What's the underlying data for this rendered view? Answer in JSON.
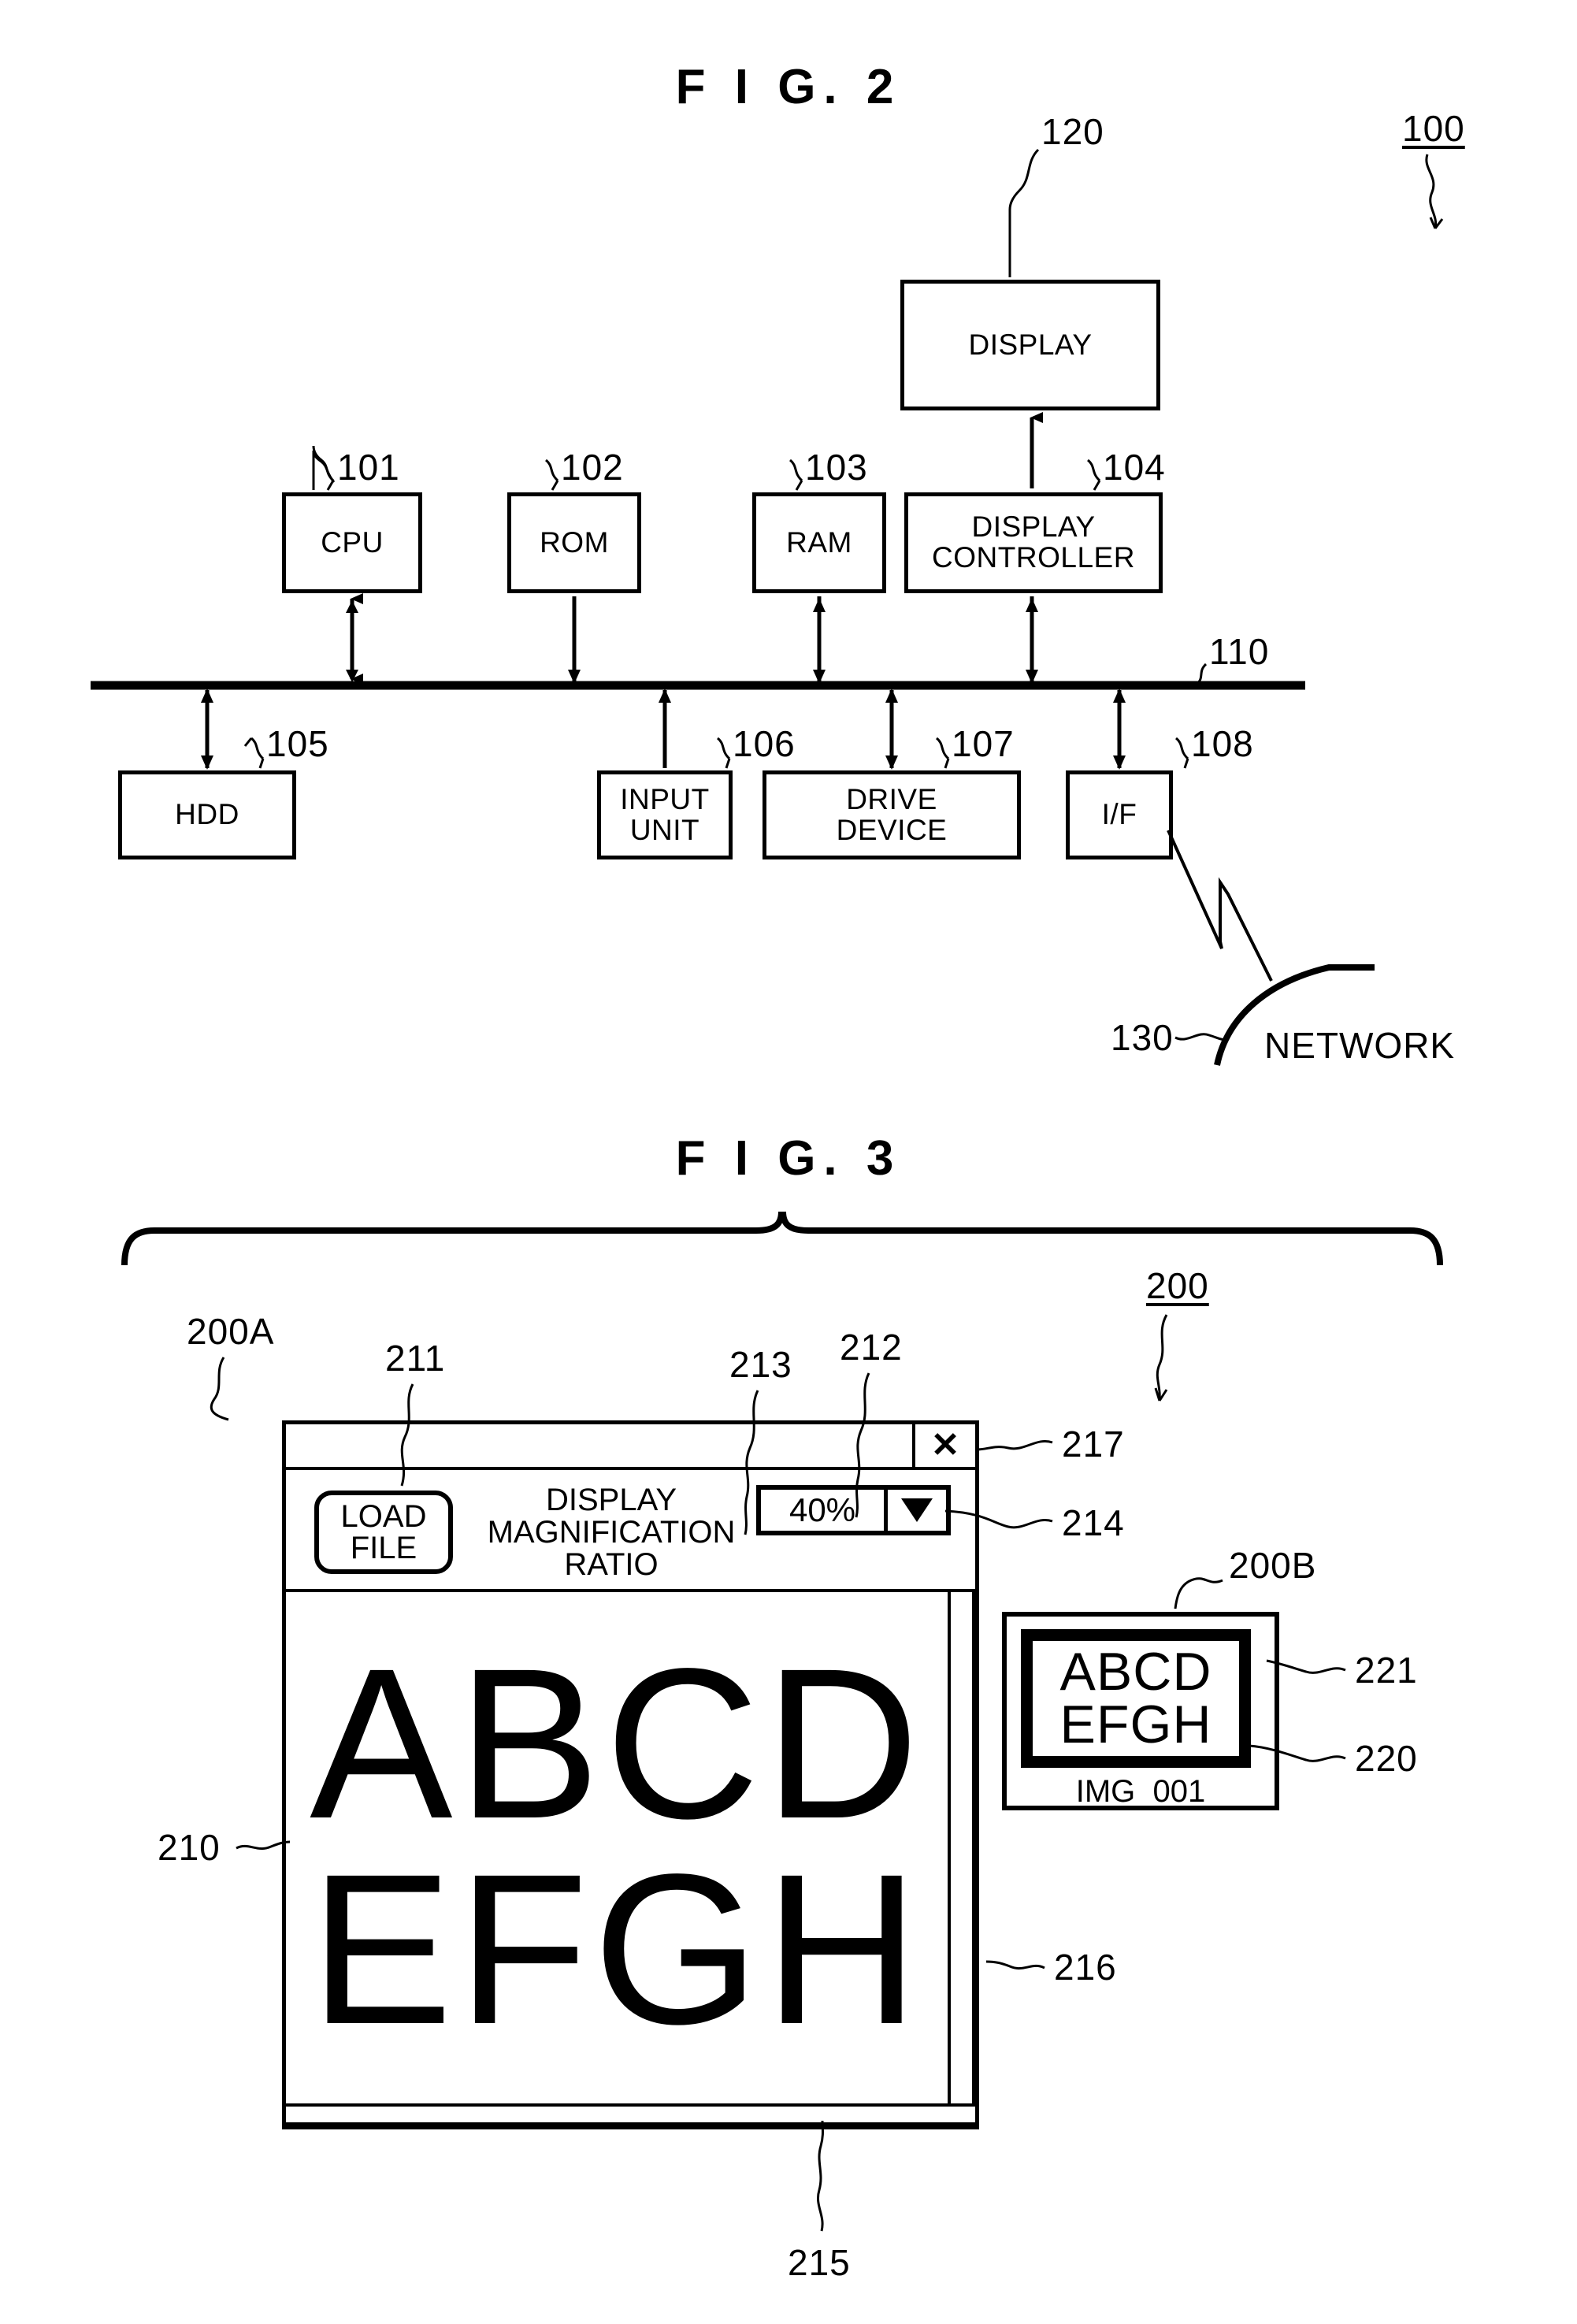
{
  "figures": [
    {
      "id": "fig2",
      "title": "F I G.  2",
      "system_ref": "100",
      "blocks": [
        {
          "ref": "120",
          "label": "DISPLAY"
        },
        {
          "ref": "101",
          "label": "CPU"
        },
        {
          "ref": "102",
          "label": "ROM"
        },
        {
          "ref": "103",
          "label": "RAM"
        },
        {
          "ref": "104",
          "label": "DISPLAY\nCONTROLLER"
        },
        {
          "ref": "105",
          "label": "HDD"
        },
        {
          "ref": "106",
          "label": "INPUT\nUNIT"
        },
        {
          "ref": "107",
          "label": "DRIVE\nDEVICE"
        },
        {
          "ref": "108",
          "label": "I/F"
        }
      ],
      "bus_ref": "110",
      "network": {
        "ref": "130",
        "label": "NETWORK"
      }
    },
    {
      "id": "fig3",
      "title": "F I G.  3",
      "screen_ref": "200",
      "main_window_ref": "200A",
      "thumb_panel_ref": "200B",
      "load_file_ref": "211",
      "mag_label_ref": "213",
      "mag_field_ref": "212",
      "mag_arrow_ref": "214",
      "close_ref": "217",
      "image_area_ref": "210",
      "vscroll_ref": "216",
      "hscroll_ref": "215",
      "thumb_image_ref": "220",
      "thumb_frame_ref": "221"
    }
  ],
  "fig2": {
    "title": "F I G.  2",
    "system_ref": "100",
    "bus_ref": "110",
    "display": {
      "label": "DISPLAY",
      "ref": "120"
    },
    "cpu": {
      "label": "CPU",
      "ref": "101"
    },
    "rom": {
      "label": "ROM",
      "ref": "102"
    },
    "ram": {
      "label": "RAM",
      "ref": "103"
    },
    "display_controller": {
      "line1": "DISPLAY",
      "line2": "CONTROLLER",
      "ref": "104"
    },
    "hdd": {
      "label": "HDD",
      "ref": "105"
    },
    "input_unit": {
      "line1": "INPUT",
      "line2": "UNIT",
      "ref": "106"
    },
    "drive_device": {
      "line1": "DRIVE",
      "line2": "DEVICE",
      "ref": "107"
    },
    "interface": {
      "label": "I/F",
      "ref": "108"
    },
    "network": {
      "label": "NETWORK",
      "ref": "130"
    }
  },
  "fig3": {
    "title": "F I G.  3",
    "screen_ref": "200",
    "window": {
      "ref": "200A",
      "close_button": {
        "glyph": "✕",
        "ref": "217"
      },
      "toolbar": {
        "load_file": {
          "line1": "LOAD",
          "line2": "FILE",
          "ref": "211"
        },
        "magnification_label": {
          "line1": "DISPLAY",
          "line2": "MAGNIFICATION",
          "line3": "RATIO",
          "ref": "213"
        },
        "magnification_value": {
          "value": "40%",
          "ref": "212"
        },
        "magnification_arrow": {
          "icon": "chevron-down-icon",
          "ref": "214"
        }
      },
      "image_area": {
        "ref": "210",
        "text_line1": "ABCD",
        "text_line2": "EFGH"
      },
      "vertical_scrollbar_ref": "216",
      "horizontal_scrollbar_ref": "215"
    },
    "thumbnail_panel": {
      "ref": "200B",
      "thumbnail": {
        "image_ref": "220",
        "frame_ref": "221",
        "text_line1": "ABCD",
        "text_line2": "EFGH",
        "filename": "IMG_001"
      }
    }
  }
}
